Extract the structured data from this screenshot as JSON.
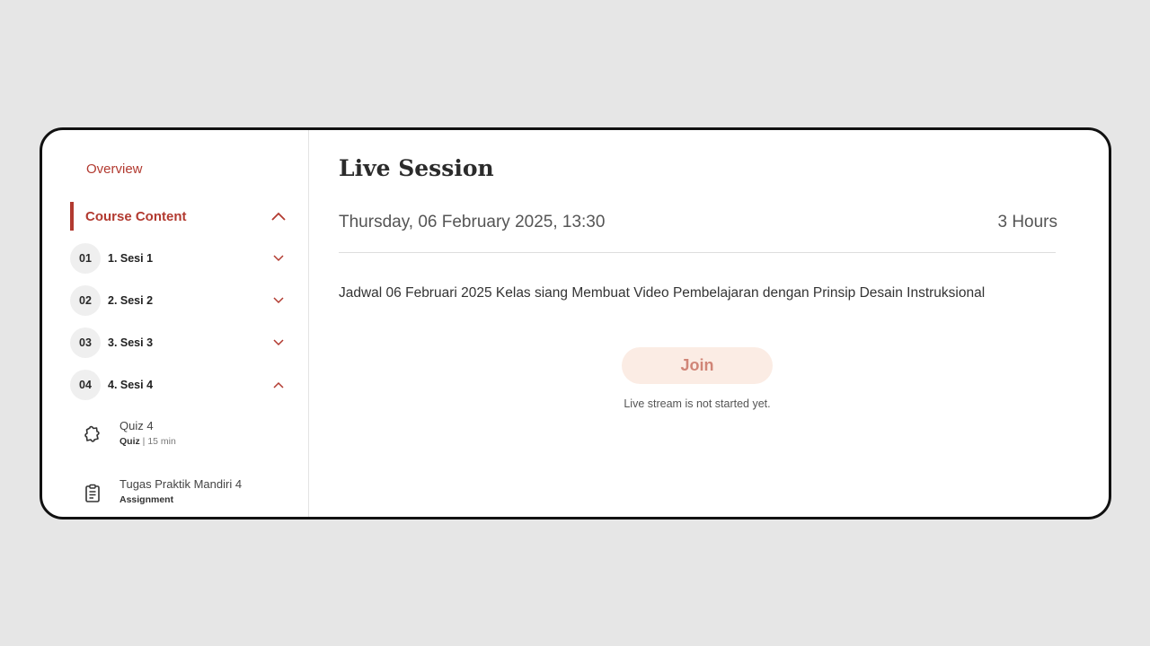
{
  "sidebar": {
    "overview_label": "Overview",
    "course_content_label": "Course Content",
    "sessions": [
      {
        "num": "01",
        "label": "1. Sesi 1",
        "expanded": false
      },
      {
        "num": "02",
        "label": "2. Sesi 2",
        "expanded": false
      },
      {
        "num": "03",
        "label": "3. Sesi 3",
        "expanded": false
      },
      {
        "num": "04",
        "label": "4. Sesi 4",
        "expanded": true
      }
    ],
    "sub_items": [
      {
        "title": "Quiz 4",
        "type": "Quiz",
        "duration": "| 15 min",
        "icon": "puzzle-icon"
      },
      {
        "title": "Tugas Praktik Mandiri 4",
        "type": "Assignment",
        "icon": "clipboard-icon"
      }
    ]
  },
  "main": {
    "title": "Live Session",
    "datetime": "Thursday, 06 February 2025, 13:30",
    "duration": "3 Hours",
    "description": "Jadwal 06 Februari 2025 Kelas siang Membuat Video Pembelajaran dengan Prinsip Desain Instruksional",
    "join_label": "Join",
    "status_note": "Live stream is not started yet."
  },
  "colors": {
    "accent": "#b23a30",
    "join_bg": "#fbece4",
    "join_text": "#d08577",
    "background": "#e6e6e6"
  }
}
